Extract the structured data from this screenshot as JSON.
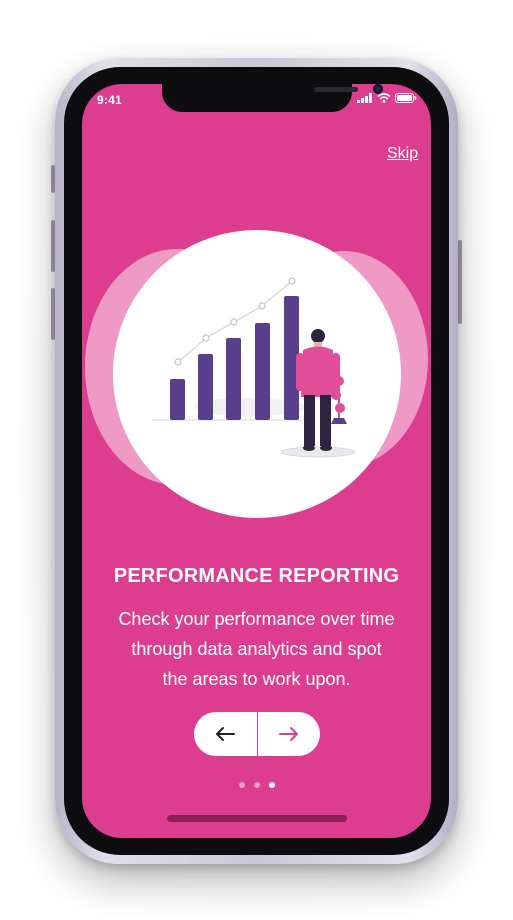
{
  "status_bar": {
    "time": "9:41",
    "icons": [
      "cellular-signal-icon",
      "wifi-icon",
      "battery-icon"
    ]
  },
  "header": {
    "skip_label": "Skip"
  },
  "onboarding": {
    "illustration": "performance-chart-person-illustration",
    "title": "PERFORMANCE REPORTING",
    "description_lines": [
      "Check your performance over time",
      "through data analytics and spot",
      "the areas to work upon."
    ],
    "prev_icon": "arrow-left-icon",
    "next_icon": "arrow-right-icon",
    "page_count": 3,
    "current_page": 3
  },
  "colors": {
    "background": "#dc3d8e",
    "accent_purple": "#5a3f8c",
    "text": "#ffffff",
    "dot_inactive": "#f19fc6",
    "dot_active": "#ffffff"
  }
}
